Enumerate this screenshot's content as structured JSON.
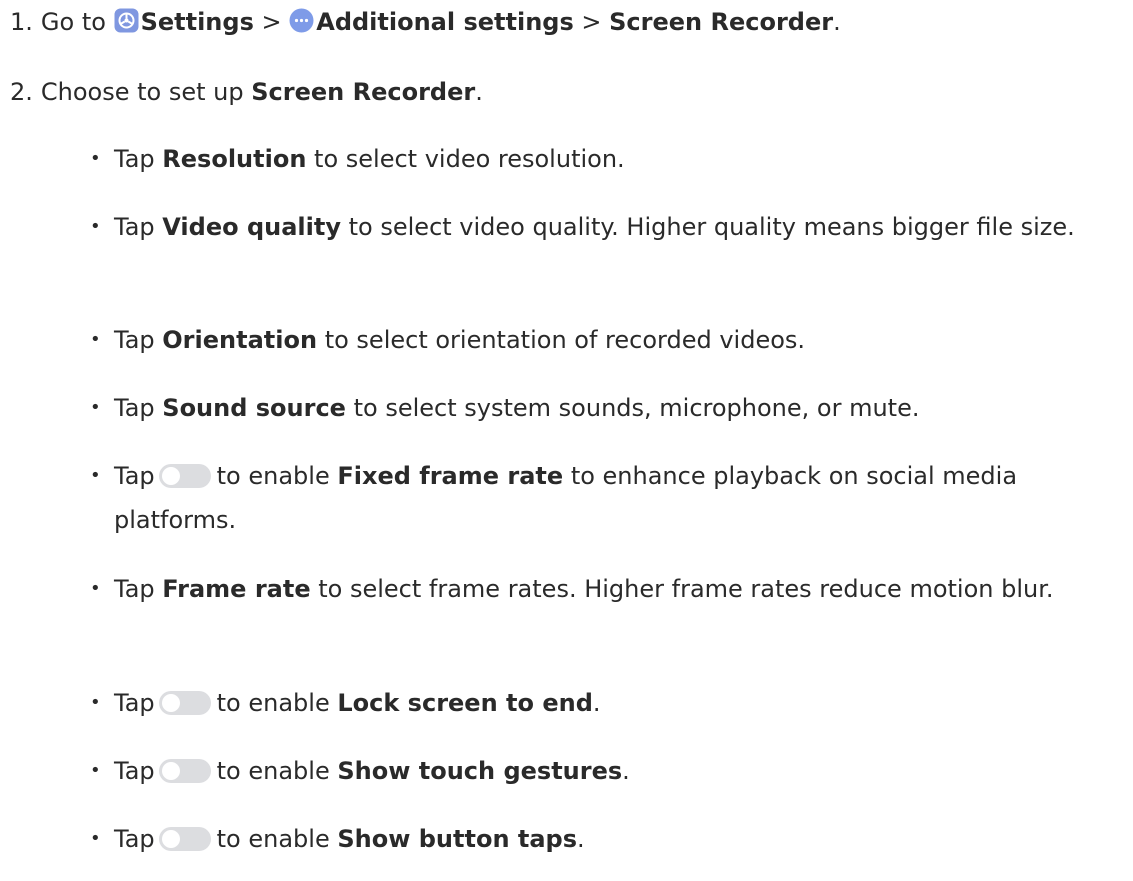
{
  "steps": [
    {
      "num": "1.",
      "go_to": "Go to",
      "settings": "Settings",
      "sep1": ">",
      "additional": "Additional settings",
      "sep2": ">",
      "screen_recorder": "Screen Recorder",
      "period": "."
    },
    {
      "num": "2.",
      "pre": "Choose to set up",
      "screen_recorder": "Screen Recorder",
      "period": "."
    }
  ],
  "bullets": {
    "dot": "•",
    "tap": "Tap",
    "to_enable": "to enable",
    "period": ".",
    "resolution": {
      "bold": "Resolution",
      "rest": "to select video resolution."
    },
    "video_quality": {
      "bold": "Video quality",
      "rest": "to select video quality. Higher quality means bigger file size."
    },
    "orientation": {
      "bold": "Orientation",
      "rest": "to select orientation of recorded videos."
    },
    "sound_source": {
      "bold": "Sound source",
      "rest": "to select system sounds, microphone, or mute."
    },
    "fixed_frame_rate": {
      "bold": "Fixed frame rate",
      "rest": "to enhance playback on social media platforms."
    },
    "frame_rate": {
      "bold": "Frame rate",
      "rest": "to select frame rates. Higher frame rates reduce motion blur."
    },
    "lock_screen": {
      "bold": "Lock screen to end"
    },
    "touch_gestures": {
      "bold": "Show touch gestures"
    },
    "button_taps": {
      "bold": "Show button taps"
    }
  },
  "colors": {
    "text": "#2a2a2a",
    "settings_icon": "#7f97e0",
    "additional_icon": "#7e9be8",
    "toggle_off": "#dcdde0"
  },
  "icons": {
    "settings": "settings-gear-icon",
    "additional": "more-dots-icon",
    "toggle": "toggle-switch-off-icon"
  }
}
